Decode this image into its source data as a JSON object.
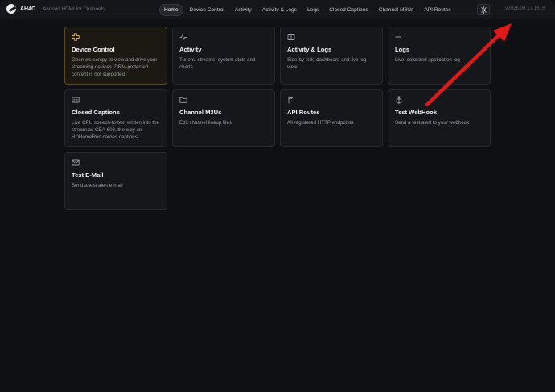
{
  "app": {
    "name": "AH4C",
    "subtitle": "Android HDMI for Channels",
    "version": "v2026.06.17.1616"
  },
  "nav": {
    "items": [
      {
        "label": "Home",
        "active": true
      },
      {
        "label": "Device Control"
      },
      {
        "label": "Activity"
      },
      {
        "label": "Activity & Logs"
      },
      {
        "label": "Logs"
      },
      {
        "label": "Closed Captions"
      },
      {
        "label": "Channel M3Us"
      },
      {
        "label": "API Routes"
      }
    ],
    "theme_toggle_icon": "sun-icon"
  },
  "cards": [
    {
      "title": "Device Control",
      "desc": "Open ws-scrcpy to view and drive your streaming devices. DRM-protected content is not supported.",
      "icon": "gamepad-icon",
      "highlight": true
    },
    {
      "title": "Activity",
      "desc": "Tuners, streams, system stats and charts",
      "icon": "pulse-icon"
    },
    {
      "title": "Activity & Logs",
      "desc": "Side-by-side dashboard and live log view",
      "icon": "split-view-icon"
    },
    {
      "title": "Logs",
      "desc": "Live, colorized application log",
      "icon": "lines-icon"
    },
    {
      "title": "Closed Captions",
      "desc": "Live CPU speech-to-text written into the stream as CEA-608, the way an HDHomeRun carries captions",
      "icon": "captions-icon"
    },
    {
      "title": "Channel M3Us",
      "desc": "Edit channel lineup files",
      "icon": "folder-icon"
    },
    {
      "title": "API Routes",
      "desc": "All registered HTTP endpoints",
      "icon": "route-icon"
    },
    {
      "title": "Test WebHook",
      "desc": "Send a test alert to your webhook",
      "icon": "anchor-icon"
    },
    {
      "title": "Test E-Mail",
      "desc": "Send a test alert e-mail",
      "icon": "mail-icon"
    }
  ],
  "colors": {
    "accent": "#d6a94a",
    "annotation_arrow": "#e01818"
  }
}
